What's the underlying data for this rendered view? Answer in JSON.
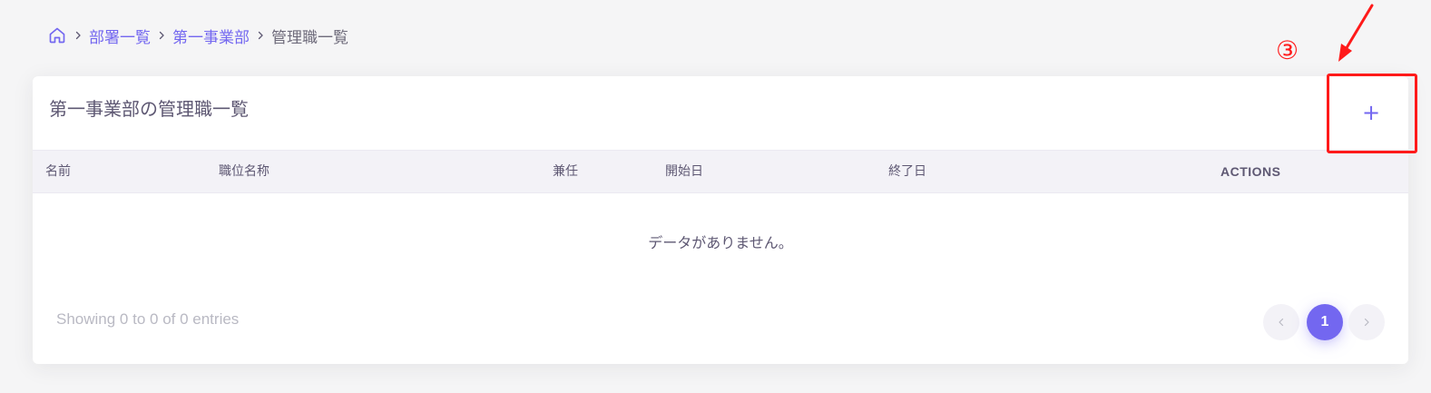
{
  "breadcrumb": {
    "items": [
      "部署一覧",
      "第一事業部"
    ],
    "current": "管理職一覧"
  },
  "card": {
    "title": "第一事業部の管理職一覧",
    "add_label": "+"
  },
  "table": {
    "columns": [
      "名前",
      "職位名称",
      "兼任",
      "開始日",
      "終了日",
      "ACTIONS"
    ],
    "empty_message": "データがありません。"
  },
  "footer": {
    "showing_text": "Showing 0 to 0 of 0 entries"
  },
  "pagination": {
    "current_page": "1"
  },
  "annotation": {
    "step": "③",
    "color": "#ff1a1a"
  },
  "colors": {
    "accent": "#7367f0",
    "text": "#5e5873",
    "header_bg": "#f3f2f7"
  },
  "icons": {
    "home": "home-icon",
    "separator": "chevron-right-icon",
    "prev": "chevron-left-icon",
    "next": "chevron-right-icon"
  }
}
